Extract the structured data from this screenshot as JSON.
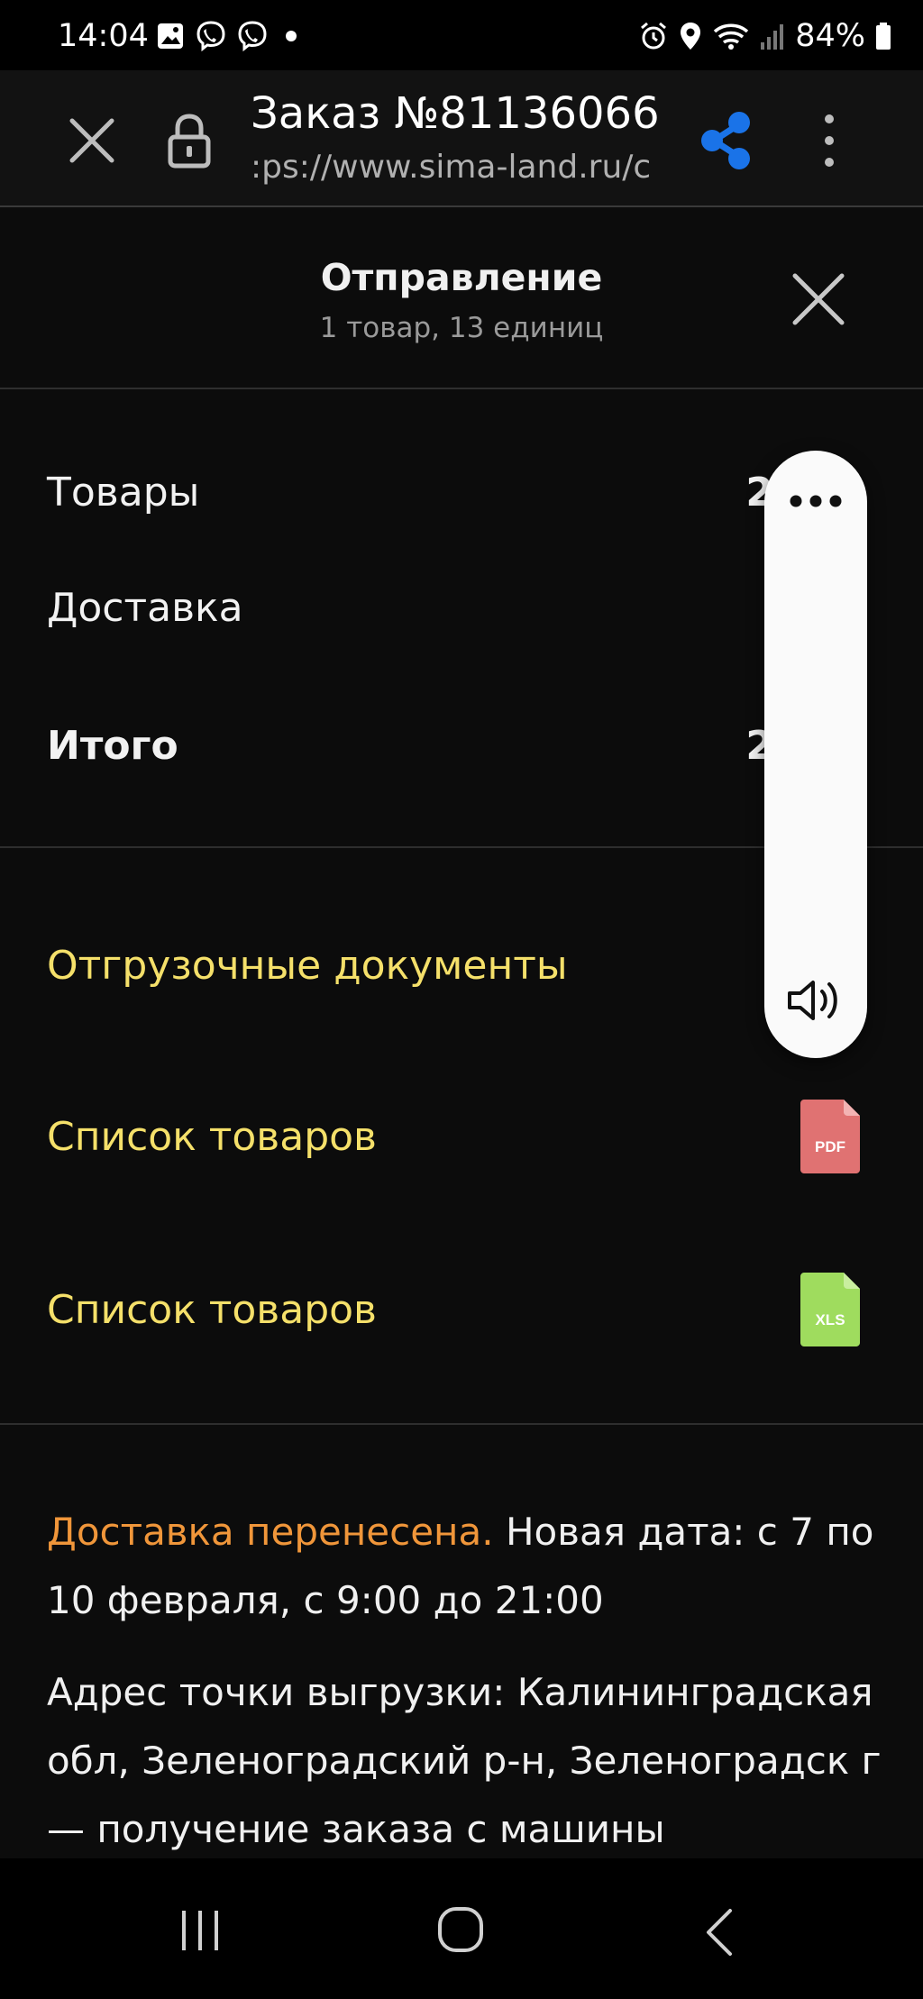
{
  "status_bar": {
    "time": "14:04",
    "left_icons": [
      "gallery-icon",
      "viber-icon",
      "viber-icon",
      "dot-icon"
    ],
    "right_icons": [
      "alarm-icon",
      "location-icon",
      "wifi-icon",
      "signal-icon",
      "battery-icon"
    ],
    "battery": "84%"
  },
  "browser": {
    "title": "Заказ №81136066",
    "url": ":ps://www.sima-land.ru/c",
    "share_color": "#1a73e8"
  },
  "sheet": {
    "title": "Отправление",
    "subtitle": "1 товар, 13 единиц"
  },
  "summary": {
    "goods_label": "Товары",
    "goods_value": "2",
    "delivery_label": "Доставка",
    "total_label": "Итого",
    "total_value": "2"
  },
  "documents": {
    "shipping_docs": "Отгрузочные документы",
    "items_pdf_label": "Список товаров",
    "pdf_badge": "PDF",
    "pdf_color": "#e07272",
    "items_xls_label": "Список товаров",
    "xls_badge": "XLS",
    "xls_color": "#9fdc5e"
  },
  "delivery_info": {
    "status_highlight": "Доставка перенесена.",
    "new_date": " Новая дата: с 7 по 10 февраля, с 9:00 до 21:00",
    "address": "Адрес точки выгрузки: Калининградская обл, Зеленоградский р-н, Зеленоградск г — получение заказа с машины"
  },
  "colors": {
    "link_yellow": "#f5e06a",
    "highlight_orange": "#f0963a",
    "background": "#0c0c0c"
  }
}
